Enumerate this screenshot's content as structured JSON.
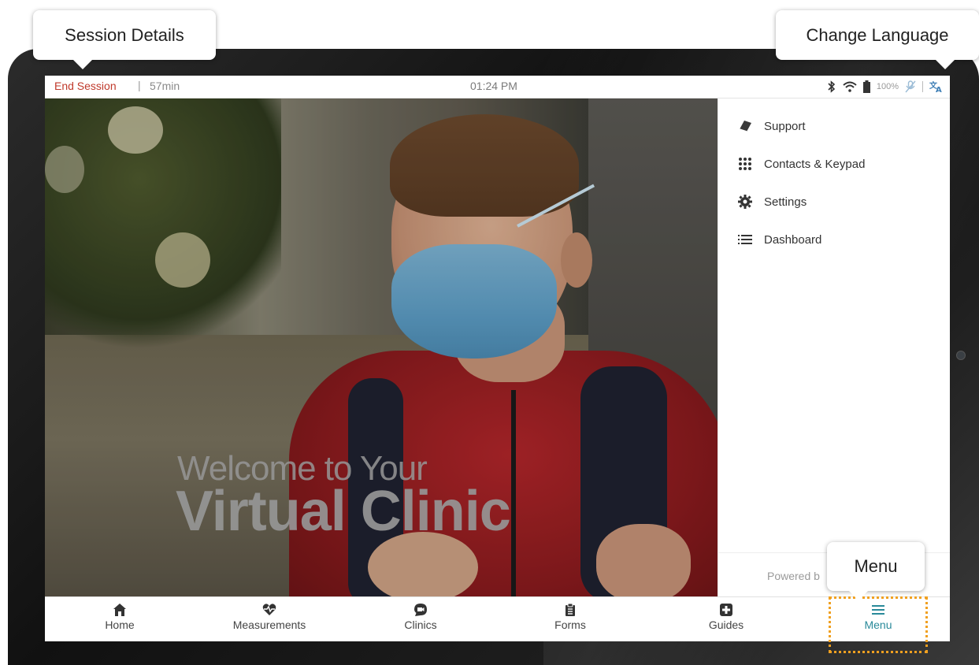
{
  "callouts": {
    "session_details": "Session Details",
    "change_language": "Change Language",
    "menu": "Menu"
  },
  "status_bar": {
    "end_session_label": "End Session",
    "separator": "|",
    "duration": "57min",
    "time": "01:24 PM",
    "battery_percent": "100%",
    "icons": [
      "bluetooth-icon",
      "wifi-icon",
      "battery-icon",
      "mic-off-icon",
      "translate-icon"
    ]
  },
  "hero": {
    "welcome_line1": "Welcome to Your",
    "welcome_line2": "Virtual Clinic"
  },
  "side_menu": {
    "items": [
      {
        "label": "Support",
        "icon": "book-icon"
      },
      {
        "label": "Contacts & Keypad",
        "icon": "keypad-icon"
      },
      {
        "label": "Settings",
        "icon": "gear-icon"
      },
      {
        "label": "Dashboard",
        "icon": "list-icon"
      }
    ],
    "powered_by": "Powered b"
  },
  "bottom_nav": {
    "items": [
      {
        "label": "Home",
        "icon": "home-icon"
      },
      {
        "label": "Measurements",
        "icon": "heart-pulse-icon"
      },
      {
        "label": "Clinics",
        "icon": "video-chat-icon"
      },
      {
        "label": "Forms",
        "icon": "clipboard-icon"
      },
      {
        "label": "Guides",
        "icon": "medical-plus-icon"
      },
      {
        "label": "Menu",
        "icon": "hamburger-icon"
      }
    ],
    "active": "Menu",
    "active_color": "#2a8a9a"
  },
  "colors": {
    "end_session": "#c0392b",
    "highlight": "#f0a020",
    "language_icon": "#3f7fb6"
  }
}
